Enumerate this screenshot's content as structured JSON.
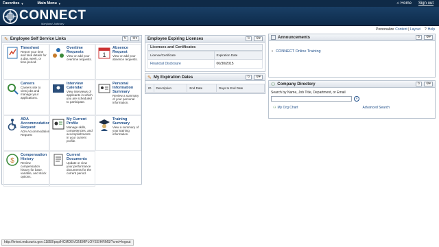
{
  "menubar": {
    "favorites": "Favorites",
    "main_menu": "Main Menu",
    "home": "Home",
    "sign_out": "Sign out"
  },
  "brand": {
    "title": "CONNECT",
    "subtitle": "Maryland Judiciary"
  },
  "personalize": {
    "label": "Personalize",
    "content": "Content",
    "sep": "|",
    "layout": "Layout",
    "help": "Help"
  },
  "ess": {
    "title": "Employee Self Service Links",
    "tiles": [
      {
        "name": "Timesheet",
        "desc": "Report your time and task details for a day, week, or time period.",
        "icon": "timesheet-icon"
      },
      {
        "name": "Overtime Requests",
        "desc": "View or add your overtime requests.",
        "icon": "overtime-icon"
      },
      {
        "name": "Absence Request",
        "desc": "View or add your absence requests.",
        "icon": "calendar-icon"
      },
      {
        "name": "Careers",
        "desc": "Careers site to view jobs and manage your applications.",
        "icon": "careers-icon"
      },
      {
        "name": "Interview Calendar",
        "desc": "View interviews of applicants in which you are scheduled to participate.",
        "icon": "interview-icon"
      },
      {
        "name": "Personal Information Summary",
        "desc": "Review a summary of your personal information.",
        "icon": "personal-info-icon"
      },
      {
        "name": "ADA Accommodation Request",
        "desc": "ADA Accommodation Request",
        "icon": "accessibility-icon"
      },
      {
        "name": "My Current Profile",
        "desc": "Manage skills, competencies, and accomplishments in your current profile.",
        "icon": "profile-icon"
      },
      {
        "name": "Training Summary",
        "desc": "View a summary of your training information.",
        "icon": "training-icon"
      },
      {
        "name": "Compensation History",
        "desc": "Review compensation history for base, variable, and stock options.",
        "icon": "compensation-icon"
      },
      {
        "name": "Current Documents",
        "desc": "Update or view your performance documents for the current period.",
        "icon": "documents-icon"
      }
    ]
  },
  "licenses": {
    "title": "Employee Expiring Licenses",
    "subtitle": "Licenses and Certificates",
    "columns": [
      "License/Certificate",
      "Expiration Date"
    ],
    "rows": [
      [
        "Financial Disclosure",
        "06/30/2015"
      ]
    ]
  },
  "expiration": {
    "title": "My Expiration Dates",
    "columns": [
      "ID",
      "Description",
      "End Date",
      "Days to End Date"
    ]
  },
  "announcements": {
    "title": "Announcements",
    "items": [
      "CONNECT Online Training"
    ]
  },
  "directory": {
    "title": "Company Directory",
    "search_label": "Search by Name, Job Title, Department, or Email",
    "search_value": "",
    "go": "»",
    "org_chart": "My Org Chart",
    "advanced": "Advanced Search"
  },
  "status": "http://hrtest.mdcourts.gov:11850/psp/HCMDEV02/EMPLOYEE/HRMS/?cmd=logout"
}
